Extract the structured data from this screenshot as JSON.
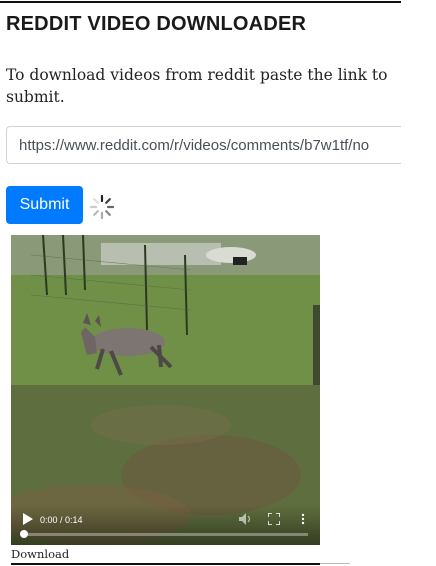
{
  "page": {
    "title": "REDDIT VIDEO DOWNLOADER",
    "instructions": "To download videos from reddit paste the link to submit."
  },
  "form": {
    "url_value": "https://www.reddit.com/r/videos/comments/b7w1tf/no",
    "submit_label": "Submit",
    "loading_icon": "spinner-icon"
  },
  "video": {
    "time_display": "0:00 / 0:14",
    "progress_fraction": 0.0,
    "icons": [
      "play-icon",
      "volume-icon",
      "fullscreen-icon",
      "more-options-icon"
    ]
  },
  "download": {
    "label": "Download"
  },
  "colors": {
    "accent": "#007bff"
  }
}
